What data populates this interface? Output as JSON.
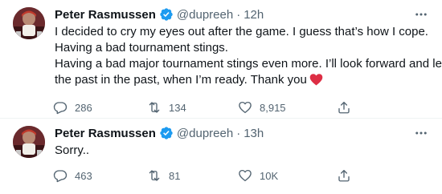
{
  "tweets": [
    {
      "author_name": "Peter Rasmussen",
      "handle": "@dupreeh",
      "separator": "·",
      "time": "12h",
      "lines": [
        "I decided to cry my eyes out after the game. I guess that’s how I cope.",
        "Having a bad tournament stings.",
        "Having a bad major tournament stings even more. I’ll look forward and leave",
        "the past in the past, when I’m ready. Thank you"
      ],
      "replies": "286",
      "retweets": "134",
      "likes": "8,915"
    },
    {
      "author_name": "Peter Rasmussen",
      "handle": "@dupreeh",
      "separator": "·",
      "time": "13h",
      "lines": [
        "Sorry.."
      ],
      "replies": "463",
      "retweets": "81",
      "likes": "10K"
    }
  ],
  "icons": {
    "verified": "verified-badge-icon",
    "more": "more-icon",
    "reply": "reply-icon",
    "retweet": "retweet-icon",
    "like": "like-icon",
    "share": "share-icon",
    "emoji": "red-heart-emoji"
  },
  "colors": {
    "verified": "#1d9bf0",
    "secondary_text": "#536471",
    "heart_emoji": "#dd2e44"
  }
}
